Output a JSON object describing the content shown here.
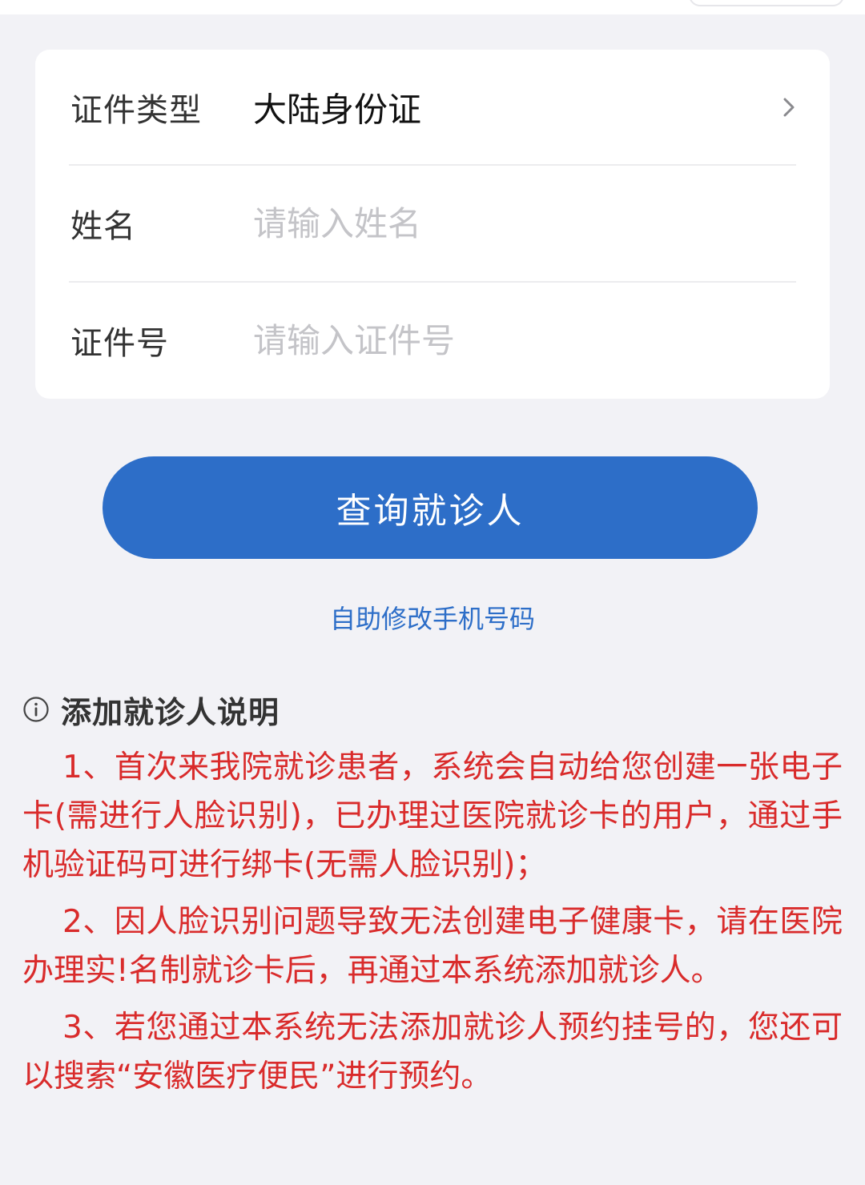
{
  "form": {
    "id_type": {
      "label": "证件类型",
      "value": "大陆身份证"
    },
    "name": {
      "label": "姓名",
      "value": "",
      "placeholder": "请输入姓名"
    },
    "id_number": {
      "label": "证件号",
      "value": "",
      "placeholder": "请输入证件号"
    }
  },
  "actions": {
    "query_label": "查询就诊人",
    "modify_phone_label": "自助修改手机号码"
  },
  "notes": {
    "title": "添加就诊人说明",
    "items": [
      "1、首次来我院就诊患者，系统会自动给您创建一张电子卡(需进行人脸识别)，已办理过医院就诊卡的用户，通过手机验证码可进行绑卡(无需人脸识别)；",
      "2、因人脸识别问题导致无法创建电子健康卡，请在医院办理实!名制就诊卡后，再通过本系统添加就诊人。",
      "3、若您通过本系统无法添加就诊人预约挂号的，您还可以搜索“安徽医疗便民”进行预约。"
    ]
  },
  "colors": {
    "primary": "#2d6ec8",
    "notice_red": "#d92b2b",
    "background": "#f2f2f6"
  },
  "icons": {
    "row_arrow": "chevron-right-icon",
    "notes": "info-icon"
  }
}
